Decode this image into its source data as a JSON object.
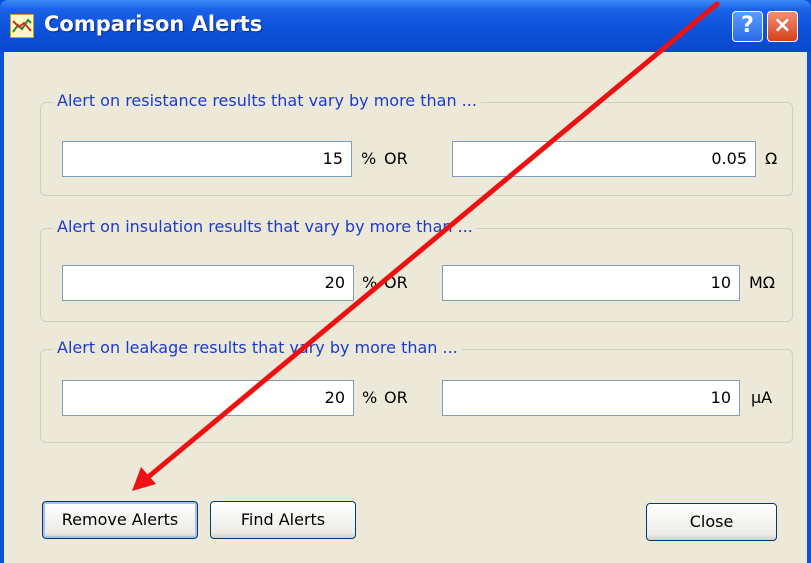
{
  "window": {
    "title": "Comparison Alerts",
    "help_glyph": "?",
    "close_glyph": "×",
    "icon": "chart-app-icon"
  },
  "groups": [
    {
      "title": "Alert on resistance results that vary by more than ...",
      "percent_value": "15",
      "percent_unit": "%",
      "or_label": "OR",
      "absolute_value": "0.05",
      "absolute_unit": "Ω"
    },
    {
      "title": "Alert on insulation results that vary by more than ...",
      "percent_value": "20",
      "percent_unit": "%",
      "or_label": "OR",
      "absolute_value": "10",
      "absolute_unit": "MΩ"
    },
    {
      "title": "Alert on leakage results that vary by more than ...",
      "percent_value": "20",
      "percent_unit": "%",
      "or_label": "OR",
      "absolute_value": "10",
      "absolute_unit": "µA"
    }
  ],
  "buttons": {
    "remove": "Remove Alerts",
    "find": "Find Alerts",
    "close": "Close"
  },
  "colors": {
    "annotation_arrow": "#ee1111",
    "group_title": "#1c3ad0"
  }
}
